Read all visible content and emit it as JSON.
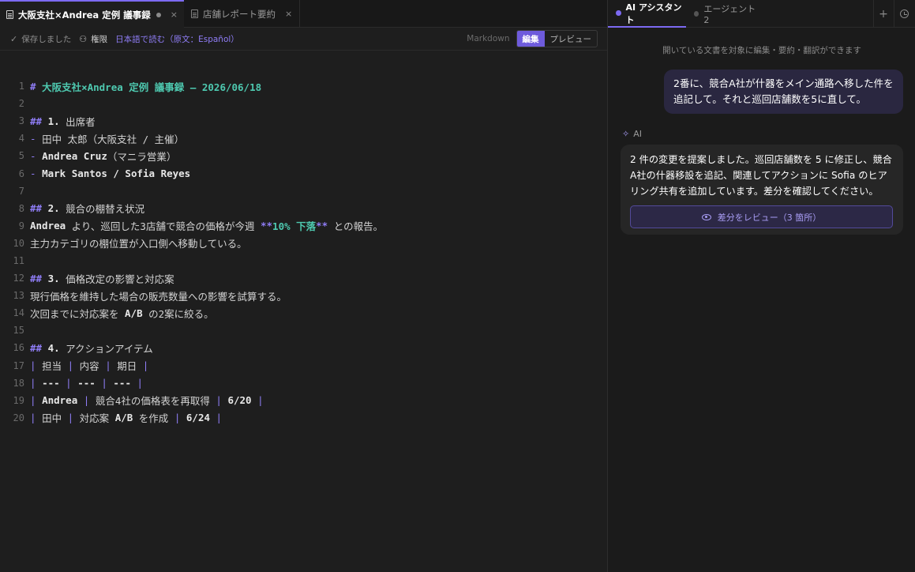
{
  "editor": {
    "tabs": [
      {
        "label": "大阪支社×Andrea 定例 議事録",
        "close": "×"
      },
      {
        "label": "店舗レポート要約",
        "close": "×"
      }
    ],
    "toolbar": {
      "saved": "保存しました",
      "permissions": "権限",
      "translate": "日本語で読む（原文：Español）",
      "mode_label": "Markdown",
      "edit": "編集",
      "preview": "プレビュー"
    },
    "lines": [
      {
        "n": "1",
        "parts": [
          {
            "c": "hm",
            "t": "# "
          },
          {
            "c": "h",
            "t": "大阪支社×Andrea 定例 議事録 — 2026/06/18"
          }
        ]
      },
      {
        "n": "2",
        "parts": []
      },
      {
        "n": "3",
        "parts": [
          {
            "c": "hm",
            "t": "## "
          },
          {
            "c": "bold",
            "t": "1. "
          },
          {
            "c": "txt",
            "t": "出席者"
          }
        ]
      },
      {
        "n": "4",
        "parts": [
          {
            "c": "dash",
            "t": "- "
          },
          {
            "c": "txt",
            "t": "田中 太郎（大阪支社 / 主催）"
          }
        ]
      },
      {
        "n": "5",
        "parts": [
          {
            "c": "dash",
            "t": "- "
          },
          {
            "c": "bold",
            "t": "Andrea Cruz"
          },
          {
            "c": "txt",
            "t": "（マニラ営業）"
          }
        ]
      },
      {
        "n": "6",
        "parts": [
          {
            "c": "dash",
            "t": "- "
          },
          {
            "c": "bold",
            "t": "Mark Santos / Sofia Reyes"
          }
        ]
      },
      {
        "n": "7",
        "parts": []
      },
      {
        "n": "8",
        "parts": [
          {
            "c": "hm",
            "t": "## "
          },
          {
            "c": "bold",
            "t": "2. "
          },
          {
            "c": "txt",
            "t": "競合の棚替え状況"
          }
        ]
      },
      {
        "n": "9",
        "parts": [
          {
            "c": "bold",
            "t": "Andrea"
          },
          {
            "c": "txt",
            "t": " より、巡回した3店舗で競合の価格が今週 "
          },
          {
            "c": "star",
            "t": "**"
          },
          {
            "c": "bt",
            "t": "10% 下落"
          },
          {
            "c": "star",
            "t": "**"
          },
          {
            "c": "txt",
            "t": " との報告。"
          }
        ]
      },
      {
        "n": "10",
        "parts": [
          {
            "c": "txt",
            "t": "主力カテゴリの棚位置が入口側へ移動している。"
          }
        ]
      },
      {
        "n": "11",
        "parts": []
      },
      {
        "n": "12",
        "parts": [
          {
            "c": "hm",
            "t": "## "
          },
          {
            "c": "bold",
            "t": "3. "
          },
          {
            "c": "txt",
            "t": "価格改定の影響と対応案"
          }
        ]
      },
      {
        "n": "13",
        "parts": [
          {
            "c": "txt",
            "t": "現行価格を維持した場合の販売数量への影響を試算する。"
          }
        ]
      },
      {
        "n": "14",
        "parts": [
          {
            "c": "txt",
            "t": "次回までに対応案を "
          },
          {
            "c": "bold",
            "t": "A/B"
          },
          {
            "c": "txt",
            "t": " の2案に絞る。"
          }
        ]
      },
      {
        "n": "15",
        "parts": []
      },
      {
        "n": "16",
        "parts": [
          {
            "c": "hm",
            "t": "## "
          },
          {
            "c": "bold",
            "t": "4. "
          },
          {
            "c": "txt",
            "t": "アクションアイテム"
          }
        ]
      },
      {
        "n": "17",
        "parts": [
          {
            "c": "pipe",
            "t": "| "
          },
          {
            "c": "txt",
            "t": "担当 "
          },
          {
            "c": "pipe",
            "t": "| "
          },
          {
            "c": "txt",
            "t": "内容 "
          },
          {
            "c": "pipe",
            "t": "| "
          },
          {
            "c": "txt",
            "t": "期日 "
          },
          {
            "c": "pipe",
            "t": "|"
          }
        ]
      },
      {
        "n": "18",
        "parts": [
          {
            "c": "pipe",
            "t": "| "
          },
          {
            "c": "bold",
            "t": "--- "
          },
          {
            "c": "pipe",
            "t": "| "
          },
          {
            "c": "bold",
            "t": "--- "
          },
          {
            "c": "pipe",
            "t": "| "
          },
          {
            "c": "bold",
            "t": "--- "
          },
          {
            "c": "pipe",
            "t": "|"
          }
        ]
      },
      {
        "n": "19",
        "parts": [
          {
            "c": "pipe",
            "t": "| "
          },
          {
            "c": "bold",
            "t": "Andrea "
          },
          {
            "c": "pipe",
            "t": "| "
          },
          {
            "c": "txt",
            "t": "競合4社の価格表を再取得 "
          },
          {
            "c": "pipe",
            "t": "| "
          },
          {
            "c": "bold",
            "t": "6/20 "
          },
          {
            "c": "pipe",
            "t": "|"
          }
        ]
      },
      {
        "n": "20",
        "parts": [
          {
            "c": "pipe",
            "t": "| "
          },
          {
            "c": "txt",
            "t": "田中 "
          },
          {
            "c": "pipe",
            "t": "| "
          },
          {
            "c": "txt",
            "t": "対応案 "
          },
          {
            "c": "bold",
            "t": "A/B"
          },
          {
            "c": "txt",
            "t": " を作成 "
          },
          {
            "c": "pipe",
            "t": "| "
          },
          {
            "c": "bold",
            "t": "6/24 "
          },
          {
            "c": "pipe",
            "t": "|"
          }
        ]
      }
    ]
  },
  "assistant": {
    "tabs": {
      "ai": "AI アシスタント",
      "agent": "エージェント 2"
    },
    "plus": "+",
    "hint": "開いている文書を対象に編集・要約・翻訳ができます",
    "user_message": "2番に、競合A社が什器をメイン通路へ移した件を追記して。それと巡回店舗数を5に直して。",
    "ai_label": "AI",
    "ai_spark": "✧",
    "ai_message": "2 件の変更を提案しました。巡回店舗数を 5 に修正し、競合A社の什器移設を追記、関連してアクションに Sofia のヒアリング共有を追加しています。差分を確認してください。",
    "review_button": "差分をレビュー（3 箇所）"
  },
  "colors": {
    "accent": "#7c6af2",
    "heading": "#4ec9b0"
  }
}
